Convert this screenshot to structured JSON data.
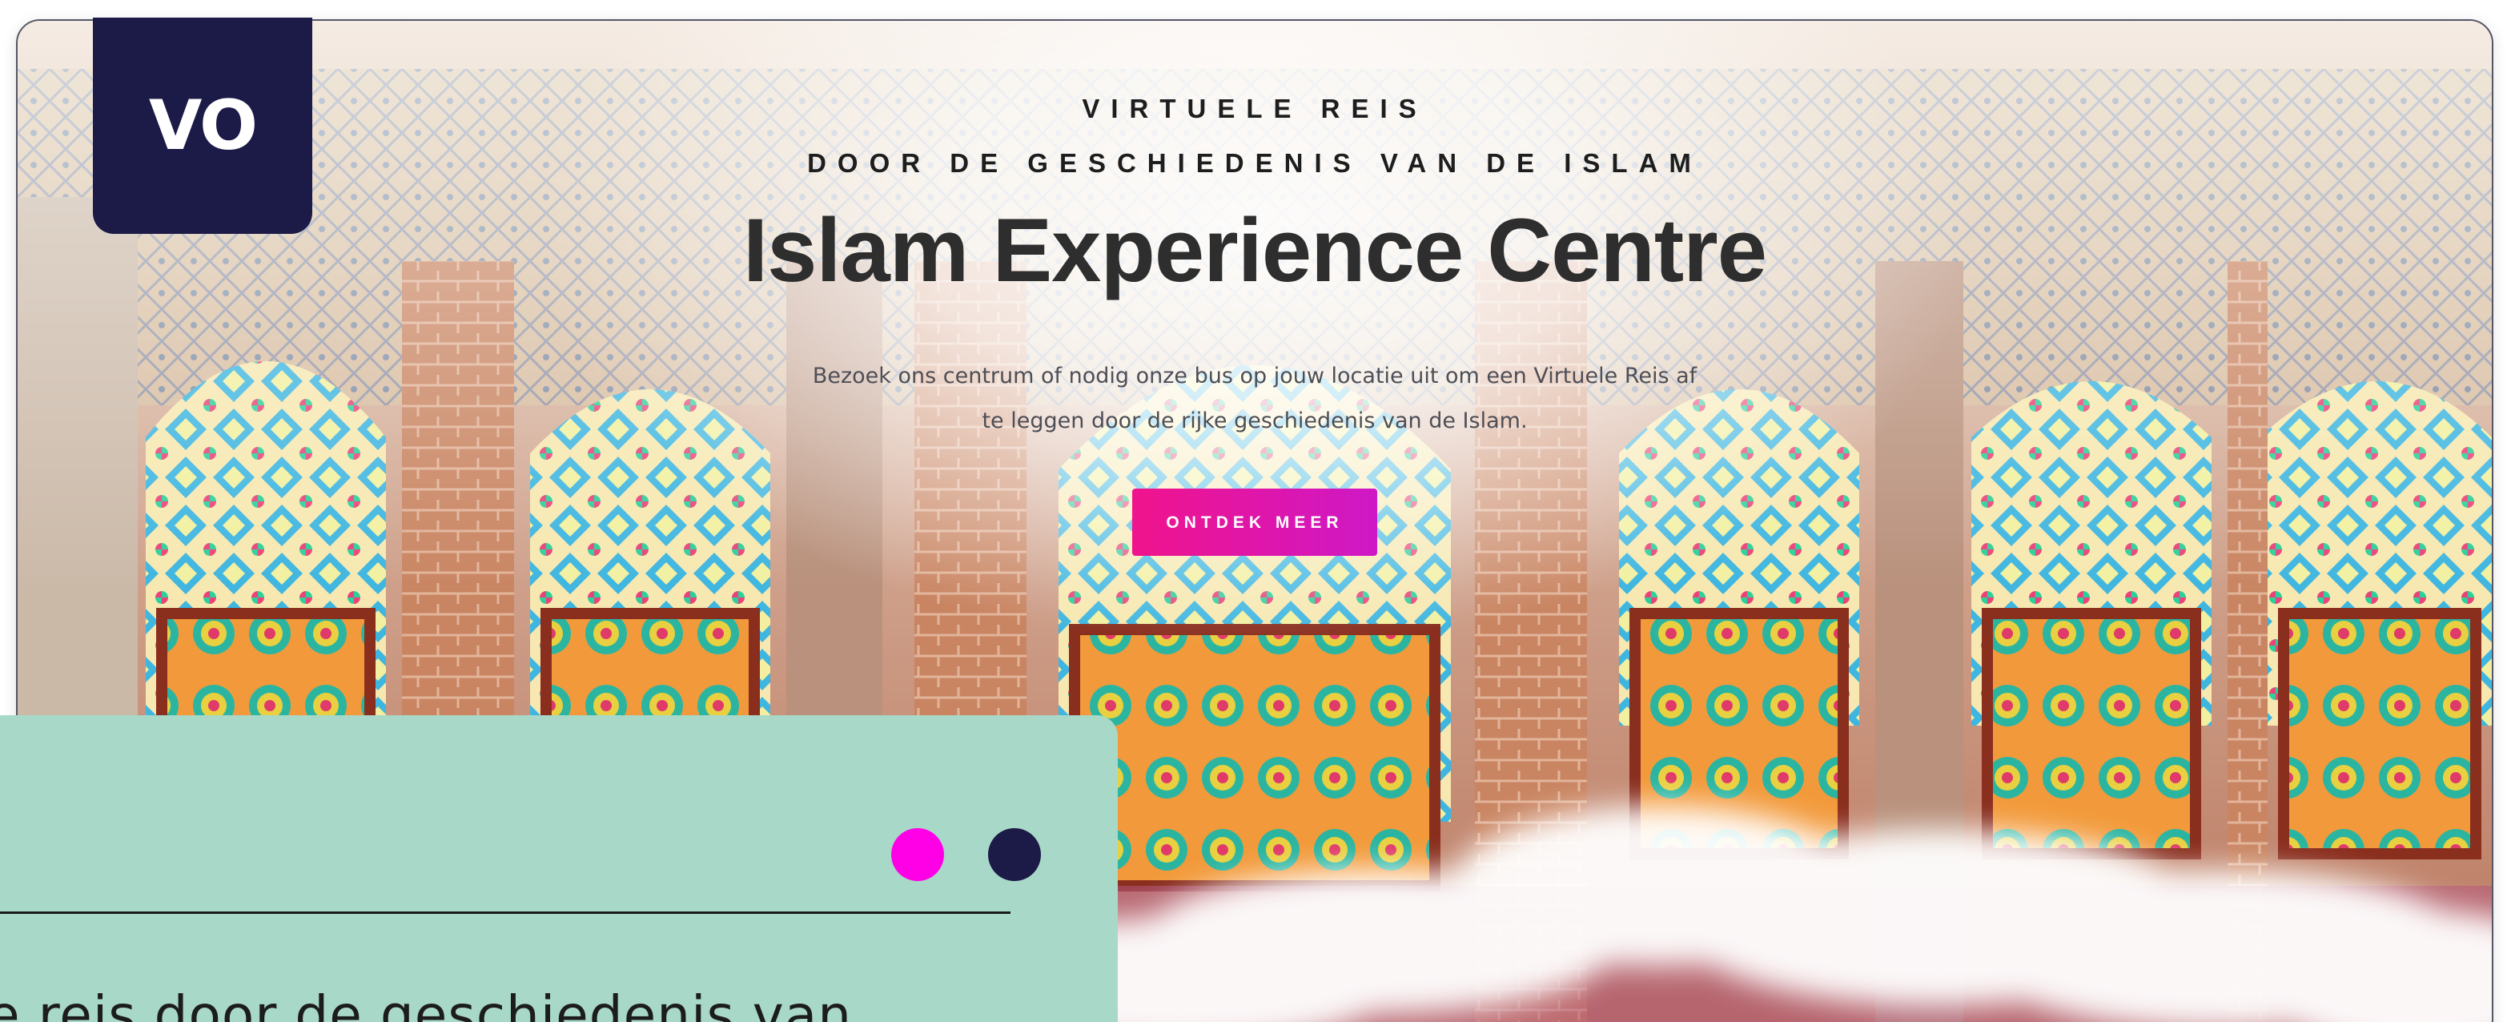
{
  "logo": {
    "text": "VO",
    "color": "#1c1a47"
  },
  "hero": {
    "kicker_line1": "VIRTUELE REIS",
    "kicker_line2": "DOOR DE GESCHIEDENIS VAN DE ISLAM",
    "title": "Islam Experience Centre",
    "description": "Bezoek ons centrum of nodig onze bus op jouw locatie uit om een Virtuele Reis af te leggen door de rijke geschiedenis van de Islam.",
    "cta_label": "ONTDEK MEER",
    "background": "mosque-stained-glass-image"
  },
  "panel": {
    "text": "e reis door de geschiedenis van",
    "color": "#a8d8c8",
    "dots": [
      {
        "name": "pink-dot",
        "color": "#ff00e6"
      },
      {
        "name": "navy-dot",
        "color": "#1c1a47"
      }
    ]
  },
  "colors": {
    "accent": "#f0148c",
    "accent_end": "#ce18c6",
    "navy": "#1c1a47",
    "mint": "#a8d8c8"
  }
}
